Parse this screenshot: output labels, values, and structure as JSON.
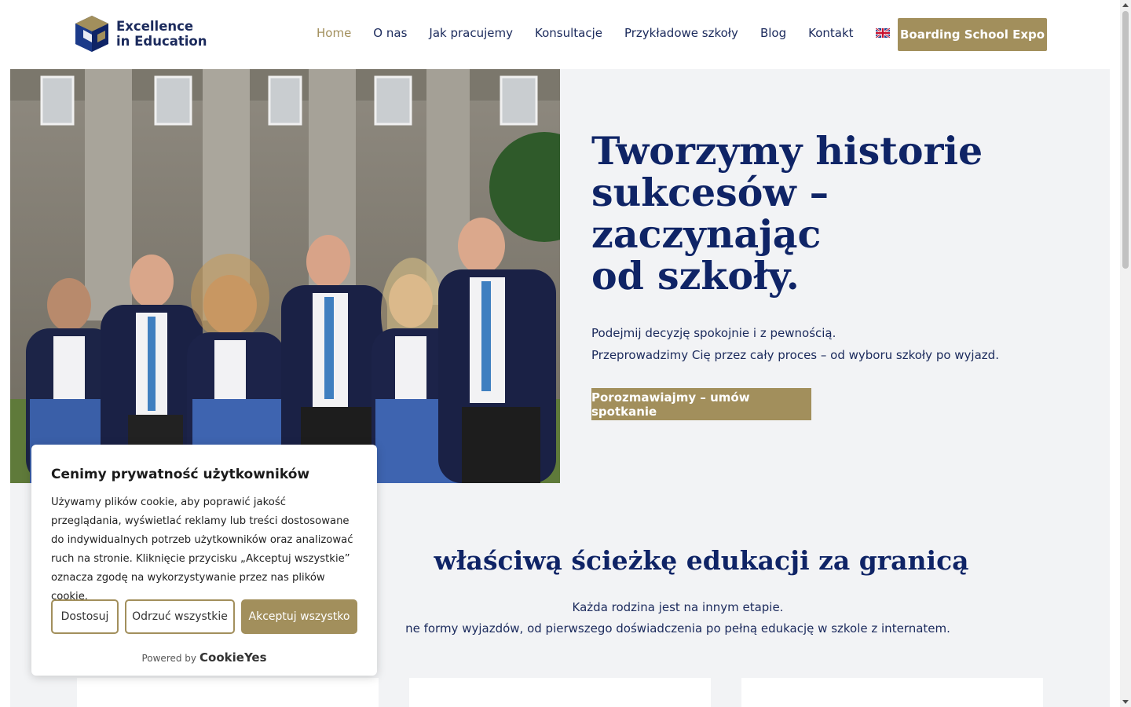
{
  "brand": {
    "line1": "Excellence",
    "line2": "in Education"
  },
  "nav": {
    "items": [
      {
        "label": "Home",
        "active": true
      },
      {
        "label": "O nas"
      },
      {
        "label": "Jak pracujemy"
      },
      {
        "label": "Konsultacje"
      },
      {
        "label": "Przykładowe szkoły"
      },
      {
        "label": "Blog"
      },
      {
        "label": "Kontakt"
      }
    ],
    "language_icon": "uk-flag-icon",
    "cta": "Boarding School Expo"
  },
  "hero": {
    "title_lines": [
      "Tworzymy historie",
      "sukcesów –",
      "zaczynając",
      "od szkoły."
    ],
    "subtitle_1": "Podejmij decyzję spokojnie i z pewnością.",
    "subtitle_2": "Przeprowadzimy Cię przez cały proces – od wyboru szkoły po wyjazd.",
    "cta": "Porozmawiajmy – umów spotkanie"
  },
  "section": {
    "title": "właściwą ścieżkę edukacji za granicą",
    "desc_1": "Każda rodzina jest na innym etapie.",
    "desc_2": "ne formy wyjazdów, od pierwszego doświadczenia po pełną edukację w szkole z internatem."
  },
  "cookie": {
    "title": "Cenimy prywatność użytkowników",
    "text": "Używamy plików cookie, aby poprawić jakość przeglądania, wyświetlać reklamy lub treści dostosowane do indywidualnych potrzeb użytkowników oraz analizować ruch na stronie. Kliknięcie przycisku „Akceptuj wszystkie” oznacza zgodę na wykorzystywanie przez nas plików cookie.",
    "btn_customize": "Dostosuj",
    "btn_reject": "Odrzuć wszystkie",
    "btn_accept": "Akceptuj wszystko",
    "powered_by": "Powered by",
    "powered_brand": "CookieYes"
  },
  "colors": {
    "navy": "#0f2466",
    "gold": "#a28f5c",
    "hero_bg": "#f2f3f5"
  }
}
